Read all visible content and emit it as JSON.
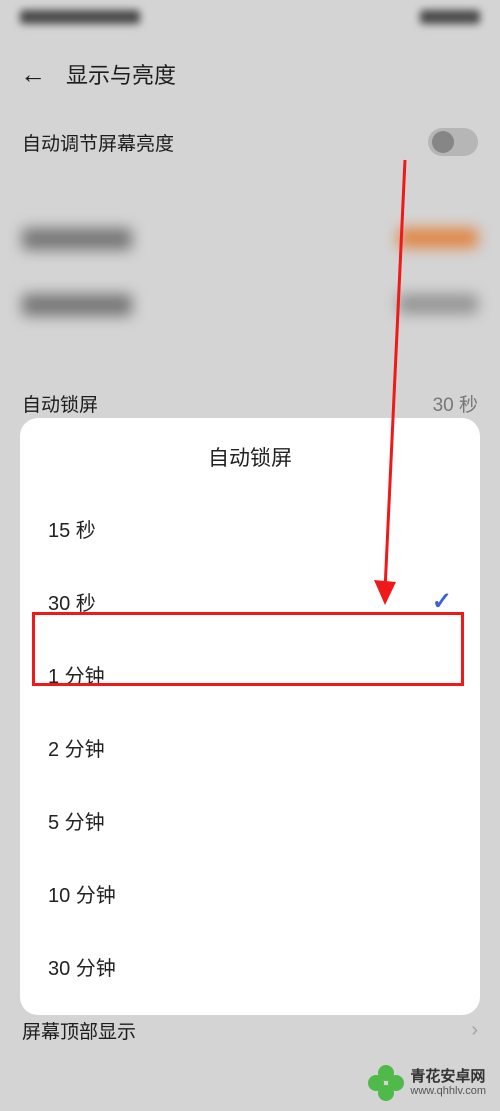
{
  "header": {
    "title": "显示与亮度"
  },
  "settings": {
    "auto_brightness_label": "自动调节屏幕亮度",
    "auto_lock_label": "自动锁屏",
    "auto_lock_value": "30 秒",
    "screen_top_display_label": "屏幕顶部显示"
  },
  "sheet": {
    "title": "自动锁屏",
    "options": [
      {
        "label": "15 秒",
        "selected": false
      },
      {
        "label": "30 秒",
        "selected": true
      },
      {
        "label": "1 分钟",
        "selected": false
      },
      {
        "label": "2 分钟",
        "selected": false
      },
      {
        "label": "5 分钟",
        "selected": false
      },
      {
        "label": "10 分钟",
        "selected": false
      },
      {
        "label": "30 分钟",
        "selected": false
      }
    ]
  },
  "annotation": {
    "highlight_option_index": 2,
    "arrow_color": "#f01818"
  },
  "watermark": {
    "title": "青花安卓网",
    "url": "www.qhhlv.com"
  }
}
